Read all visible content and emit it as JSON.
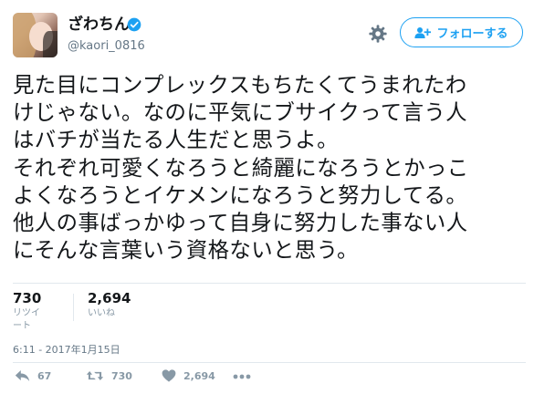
{
  "user": {
    "display_name": "ざわちん",
    "screen_name": "@kaori_0816"
  },
  "header": {
    "follow_label": "フォローする"
  },
  "tweet": {
    "lines": [
      "見た目にコンプレックスもちたくてうまれたわ",
      "けじゃない。なのに平気にブサイクって言う人",
      "はバチが当たる人生だと思うよ。",
      "それぞれ可愛くなろうと綺麗になろうとかっこ",
      "よくなろうとイケメンになろうと努力してる。",
      "他人の事ばっかゆって自身に努力した事ない人",
      "にそんな言葉いう資格ないと思う。"
    ],
    "timestamp": "6:11 - 2017年1月15日"
  },
  "stats": {
    "retweets_value": "730",
    "retweets_label": "リツイート",
    "likes_value": "2,694",
    "likes_label": "いいね"
  },
  "actions": {
    "reply_count": "67",
    "retweet_count": "730",
    "like_count": "2,694"
  },
  "icons": {
    "verified": "verified-badge-icon",
    "settings": "gear-icon",
    "follow": "add-user-icon",
    "reply": "reply-icon",
    "retweet": "retweet-icon",
    "like": "heart-icon",
    "more": "more-icon"
  },
  "colors": {
    "accent": "#1da1f2",
    "text": "#14171a",
    "muted": "#657786",
    "icon_gray": "#8899a6"
  }
}
